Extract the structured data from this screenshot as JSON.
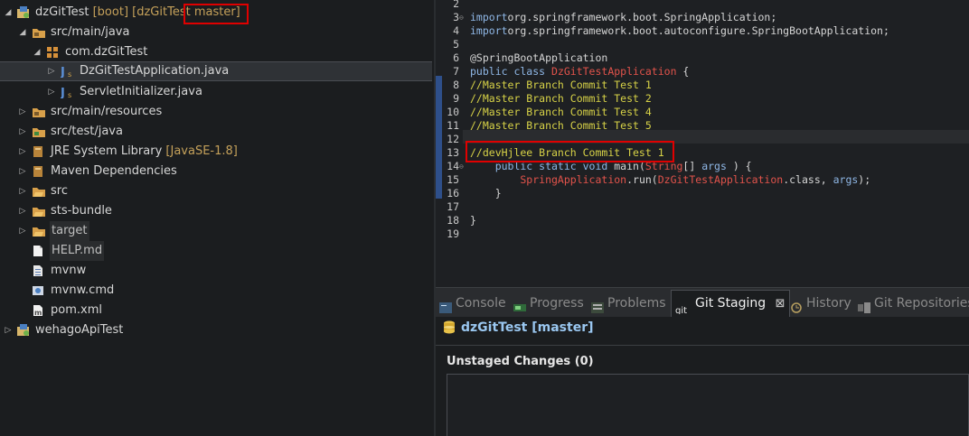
{
  "explorer": {
    "project": {
      "name": "dzGitTest",
      "boot_tag": "[boot]",
      "repo_tag": "[dzGitTest",
      "branch": "master]"
    },
    "items": [
      {
        "label": "src/main/java"
      },
      {
        "label": "com.dzGitTest"
      },
      {
        "label": "DzGitTestApplication.java"
      },
      {
        "label": "ServletInitializer.java"
      },
      {
        "label": "src/main/resources"
      },
      {
        "label": "src/test/java"
      },
      {
        "label": "JRE System Library",
        "suffix": "[JavaSE-1.8]"
      },
      {
        "label": "Maven Dependencies"
      },
      {
        "label": "src"
      },
      {
        "label": "sts-bundle"
      },
      {
        "label": "target"
      },
      {
        "label": "HELP.md"
      },
      {
        "label": "mvnw"
      },
      {
        "label": "mvnw.cmd"
      },
      {
        "label": "pom.xml"
      },
      {
        "label": "wehagoApiTest"
      }
    ]
  },
  "editor": {
    "lines": [
      {
        "num": "2",
        "parts": []
      },
      {
        "num": "3",
        "fold": "⊖",
        "parts": [
          [
            "kw",
            "import"
          ],
          [
            "",
            "org.springframework.boot.SpringApplication;"
          ]
        ]
      },
      {
        "num": "4",
        "parts": [
          [
            "kw",
            "import"
          ],
          [
            "",
            "org.springframework.boot.autoconfigure.SpringBootApplication;"
          ]
        ]
      },
      {
        "num": "5",
        "parts": []
      },
      {
        "num": "6",
        "parts": [
          [
            "",
            "@SpringBootApplication"
          ]
        ]
      },
      {
        "num": "7",
        "parts": [
          [
            "kw",
            "public class "
          ],
          [
            "cls",
            "DzGitTestApplication"
          ],
          [
            "",
            " {"
          ]
        ]
      },
      {
        "num": "8",
        "parts": [
          [
            "cm",
            "//Master Branch Commit Test 1"
          ]
        ]
      },
      {
        "num": "9",
        "parts": [
          [
            "cm",
            "//Master Branch Commit Test 2"
          ]
        ]
      },
      {
        "num": "10",
        "parts": [
          [
            "cm",
            "//Master Branch Commit Test 4"
          ]
        ]
      },
      {
        "num": "11",
        "parts": [
          [
            "cm",
            "//Master Branch Commit Test 5"
          ]
        ]
      },
      {
        "num": "12",
        "parts": []
      },
      {
        "num": "13",
        "parts": [
          [
            "cm",
            "//devHjlee Branch Commit Test 1"
          ]
        ]
      },
      {
        "num": "14",
        "fold": "⊖",
        "parts": [
          [
            "kw",
            "    public static void "
          ],
          [
            "",
            "main("
          ],
          [
            "cls",
            "String"
          ],
          [
            "",
            "[] "
          ],
          [
            "kw",
            "args"
          ],
          [
            "",
            " ) {"
          ]
        ]
      },
      {
        "num": "15",
        "parts": [
          [
            "cls",
            "        SpringApplication"
          ],
          [
            "",
            ".run("
          ],
          [
            "cls",
            "DzGitTestApplication"
          ],
          [
            "",
            ".class, "
          ],
          [
            "kw",
            "args"
          ],
          [
            "",
            ");"
          ]
        ]
      },
      {
        "num": "16",
        "parts": [
          [
            "",
            "    }"
          ]
        ]
      },
      {
        "num": "17",
        "parts": []
      },
      {
        "num": "18",
        "parts": [
          [
            "",
            "}"
          ]
        ]
      },
      {
        "num": "19",
        "parts": []
      }
    ]
  },
  "bottom": {
    "tabs": [
      {
        "label": "Console"
      },
      {
        "label": "Progress"
      },
      {
        "label": "Problems"
      },
      {
        "label": "Git Staging",
        "close": "⊠"
      },
      {
        "label": "History"
      },
      {
        "label": "Git Repositories"
      }
    ],
    "repo_title": "dzGitTest [master]",
    "unstaged_label": "Unstaged Changes (0)"
  },
  "colors": {
    "accent_box": "#e00000",
    "comment": "#d7d247",
    "keyword": "#8fb7e6",
    "class": "#e2534b"
  }
}
